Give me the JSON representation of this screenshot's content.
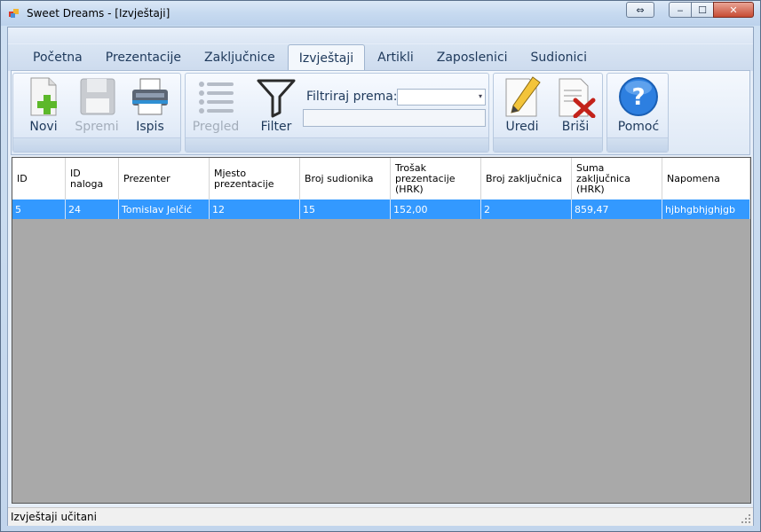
{
  "window": {
    "title": "Sweet Dreams - [Izvještaji]",
    "controls": {
      "minimize": "‒",
      "maximize": "☐",
      "close": "✕",
      "restore_ext": "⇔"
    }
  },
  "tabs": [
    {
      "label": "Početna",
      "active": false
    },
    {
      "label": "Prezentacije",
      "active": false
    },
    {
      "label": "Zaključnice",
      "active": false
    },
    {
      "label": "Izvještaji",
      "active": true
    },
    {
      "label": "Artikli",
      "active": false
    },
    {
      "label": "Zaposlenici",
      "active": false
    },
    {
      "label": "Sudionici",
      "active": false
    }
  ],
  "ribbon": {
    "new_label": "Novi",
    "save_label": "Spremi",
    "print_label": "Ispis",
    "view_label": "Pregled",
    "filter_label": "Filter",
    "filter_by_label": "Filtriraj prema:",
    "filter_by_value": "",
    "filter_text": "",
    "edit_label": "Uredi",
    "delete_label": "Briši",
    "help_label": "Pomoć"
  },
  "grid": {
    "columns": [
      "ID",
      "ID naloga",
      "Prezenter",
      "Mjesto prezentacije",
      "Broj sudionika",
      "Trošak prezentacije (HRK)",
      "Broj zaključnica",
      "Suma zaključnica (HRK)",
      "Napomena"
    ],
    "rows": [
      [
        "5",
        "24",
        "Tomislav Jelčić",
        "12",
        "15",
        "152,00",
        "2",
        "859,47",
        "hjbhgbhjghjgb"
      ]
    ]
  },
  "status": {
    "text": "Izvještaji učitani"
  },
  "colors": {
    "selection": "#3399ff",
    "grid_background": "#a9a9a9",
    "ribbon_text": "#1e395b"
  }
}
